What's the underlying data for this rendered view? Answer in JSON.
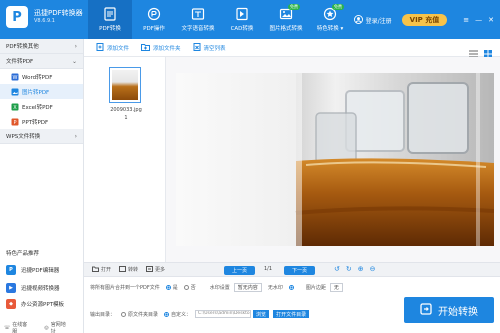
{
  "app": {
    "title": "迅捷PDF转换器",
    "version": "V8.6.9.1",
    "logo_letter": "P"
  },
  "nav": [
    {
      "label": "PDF转换",
      "icon": "pdf-convert-icon",
      "active": true
    },
    {
      "label": "PDF操作",
      "icon": "pdf-ops-icon"
    },
    {
      "label": "文字语音转换",
      "icon": "text-voice-icon"
    },
    {
      "label": "CAD转换",
      "icon": "cad-icon"
    },
    {
      "label": "图片格式转换",
      "icon": "image-format-icon",
      "badge": "免费"
    },
    {
      "label": "特色转换 ▾",
      "icon": "special-convert-icon",
      "badge": "免费"
    }
  ],
  "header": {
    "login_label": "登录/注册",
    "vip_label": "VIP 充值"
  },
  "sidebar": {
    "sections": [
      {
        "label": "PDF转换其他",
        "expanded": false,
        "items": []
      },
      {
        "label": "文件转PDF",
        "expanded": true,
        "items": [
          {
            "label": "Word转PDF",
            "icon": "word-icon"
          },
          {
            "label": "图片转PDF",
            "icon": "image-icon",
            "active": true
          },
          {
            "label": "Excel转PDF",
            "icon": "excel-icon"
          },
          {
            "label": "PPT转PDF",
            "icon": "ppt-icon"
          }
        ]
      },
      {
        "label": "WPS文件转换",
        "expanded": false,
        "items": []
      }
    ],
    "recommend_title": "特色产品推荐",
    "recommend": [
      {
        "label": "迅捷PDF编辑器",
        "icon": "pdf-editor-icon",
        "color": "#1e86e0"
      },
      {
        "label": "迅捷视频转换器",
        "icon": "video-convert-icon",
        "color": "#2a78e0"
      },
      {
        "label": "办公资源PPT模板",
        "icon": "ppt-template-icon",
        "color": "#e85a3a"
      }
    ],
    "footer": {
      "service_label": "在线客服",
      "website_label": "官网地址"
    }
  },
  "toolbar": {
    "add_file": "添加文件",
    "add_folder": "添加文件夹",
    "clear_list": "清空列表"
  },
  "files": [
    {
      "name": "2009033.jpg",
      "page": "1"
    }
  ],
  "controls": {
    "open": "打开",
    "rotate": "转转",
    "more": "更多",
    "prev": "上一页",
    "page": "1/1",
    "next": "下一页"
  },
  "options": {
    "merge_label": "将所有图片合并到一个PDF文件",
    "merge_yes": "是",
    "merge_no": "否",
    "watermark_label": "水印设置",
    "watermark_value": "暂无内容",
    "watermark_none": "无水印",
    "page_margin_label": "图片边距",
    "page_margin_value": "无",
    "output_label": "输出目录：",
    "output_original": "原文件夹目录",
    "output_custom": "自定义：",
    "output_path": "C:\\Users\\admin\\Desktop",
    "browse": "浏览",
    "open_folder": "打开文件目录",
    "convert_label": "开始转换"
  },
  "colors": {
    "primary": "#1e86e0",
    "vip": "#f7c34a",
    "badge": "#29b34a"
  }
}
